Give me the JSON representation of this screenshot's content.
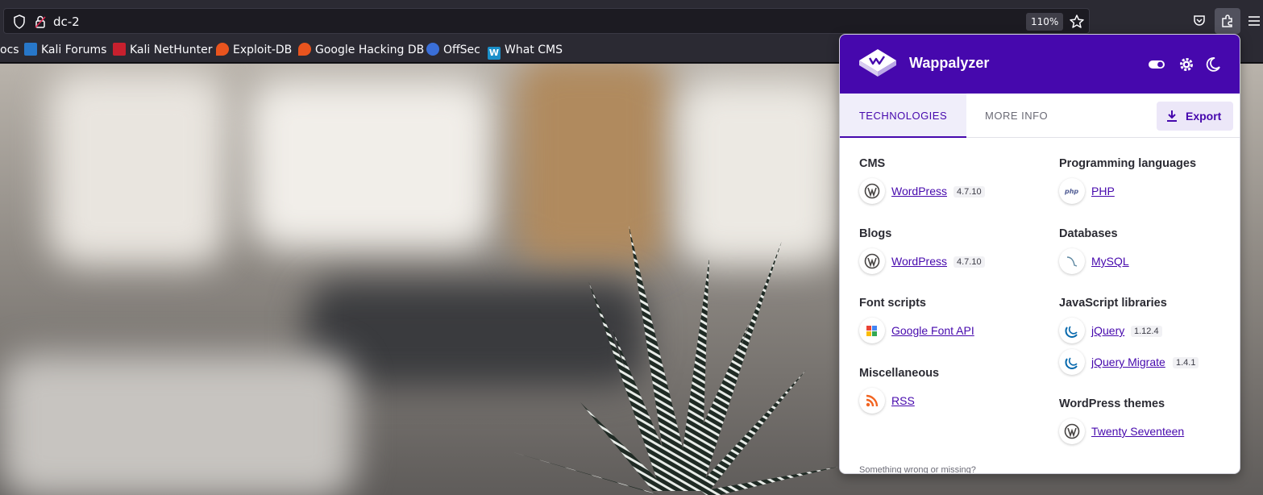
{
  "browser": {
    "url": "dc-2",
    "zoom": "110%"
  },
  "bookmarks": [
    {
      "label": "ocs",
      "icon": "docs-icon"
    },
    {
      "label": "Kali Forums",
      "icon": "kali-icon"
    },
    {
      "label": "Kali NetHunter",
      "icon": "kali-icon"
    },
    {
      "label": "Exploit-DB",
      "icon": "exploitdb-icon"
    },
    {
      "label": "Google Hacking DB",
      "icon": "exploitdb-icon"
    },
    {
      "label": "OffSec",
      "icon": "offsec-icon"
    },
    {
      "label": "What CMS",
      "icon": "whatcms-icon"
    }
  ],
  "wappalyzer": {
    "brand": "Wappalyzer",
    "tabs": [
      "TECHNOLOGIES",
      "MORE INFO"
    ],
    "export_label": "Export",
    "accent": "#4608ad",
    "categories_left": [
      {
        "title": "CMS",
        "items": [
          {
            "name": "WordPress",
            "version": "4.7.10",
            "icon": "wordpress-icon"
          }
        ]
      },
      {
        "title": "Blogs",
        "items": [
          {
            "name": "WordPress",
            "version": "4.7.10",
            "icon": "wordpress-icon"
          }
        ]
      },
      {
        "title": "Font scripts",
        "items": [
          {
            "name": "Google Font API",
            "version": "",
            "icon": "google-font-icon"
          }
        ]
      },
      {
        "title": "Miscellaneous",
        "items": [
          {
            "name": "RSS",
            "version": "",
            "icon": "rss-icon"
          }
        ]
      }
    ],
    "categories_right": [
      {
        "title": "Programming languages",
        "items": [
          {
            "name": "PHP",
            "version": "",
            "icon": "php-icon"
          }
        ]
      },
      {
        "title": "Databases",
        "items": [
          {
            "name": "MySQL",
            "version": "",
            "icon": "mysql-icon"
          }
        ]
      },
      {
        "title": "JavaScript libraries",
        "items": [
          {
            "name": "jQuery",
            "version": "1.12.4",
            "icon": "jquery-icon"
          },
          {
            "name": "jQuery Migrate",
            "version": "1.4.1",
            "icon": "jquery-icon"
          }
        ]
      },
      {
        "title": "WordPress themes",
        "items": [
          {
            "name": "Twenty Seventeen",
            "version": "",
            "icon": "wordpress-icon"
          }
        ]
      }
    ],
    "footer_note": "Something wrong or missing?"
  }
}
